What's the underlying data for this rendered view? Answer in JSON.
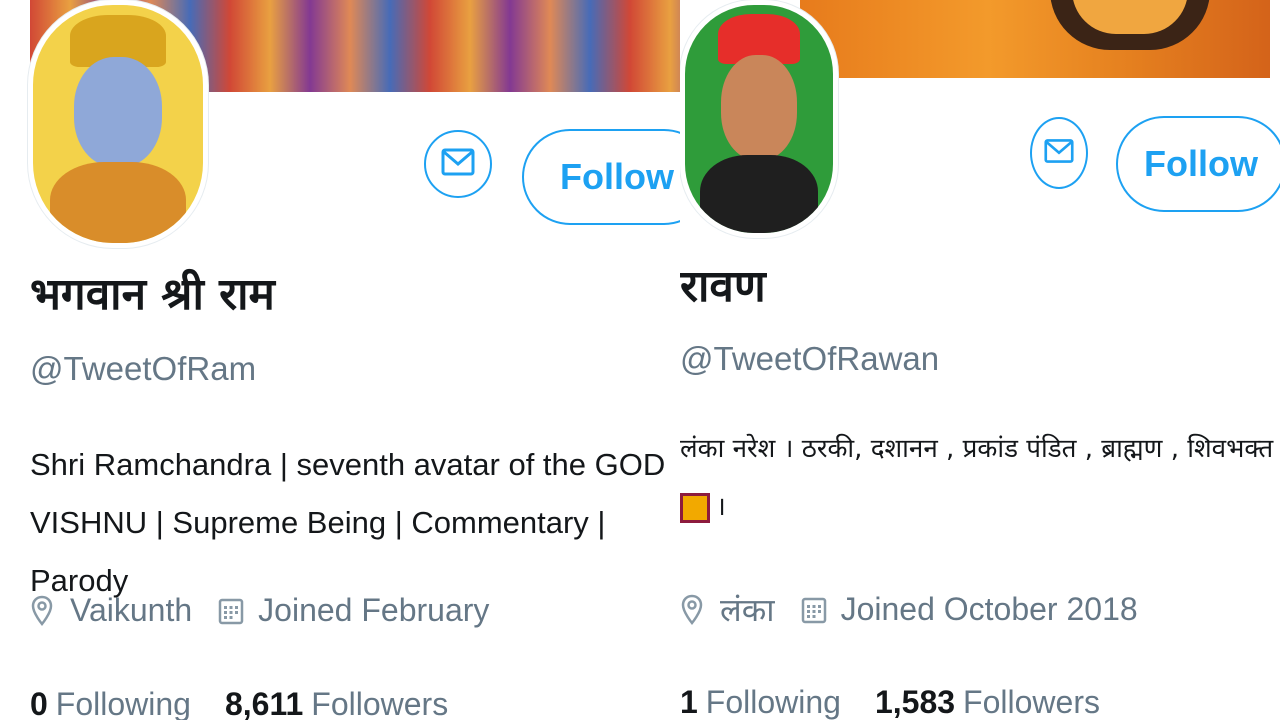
{
  "profiles": [
    {
      "name": "भगवान श्री राम",
      "handle": "@TweetOfRam",
      "bio_line1": "Shri Ramchandra | seventh avatar of the GOD",
      "bio_line2": "VISHNU | Supreme Being | Commentary | Parody",
      "location": "Vaikunth",
      "joined": "Joined February",
      "following_count": "0",
      "following_label": "Following",
      "followers_count": "8,611",
      "followers_label": "Followers",
      "follow_label": "Follow"
    },
    {
      "name": "रावण",
      "handle": "@TweetOfRawan",
      "bio_line1": "लंका नरेश । ठरकी, दशानन , प्रकांड पंडित , ब्राह्मण , शिवभक्त",
      "bio_line2": "।",
      "location": "लंका",
      "joined": "Joined October 2018",
      "following_count": "1",
      "following_label": "Following",
      "followers_count": "1,583",
      "followers_label": "Followers",
      "follow_label": "Follow"
    }
  ],
  "colors": {
    "accent": "#1da1f2",
    "text": "#14171a",
    "muted": "#657786"
  },
  "icons": {
    "message": "envelope-icon",
    "location": "map-pin-icon",
    "joined": "calendar-icon",
    "flag": "sri-lanka-flag-emoji"
  }
}
